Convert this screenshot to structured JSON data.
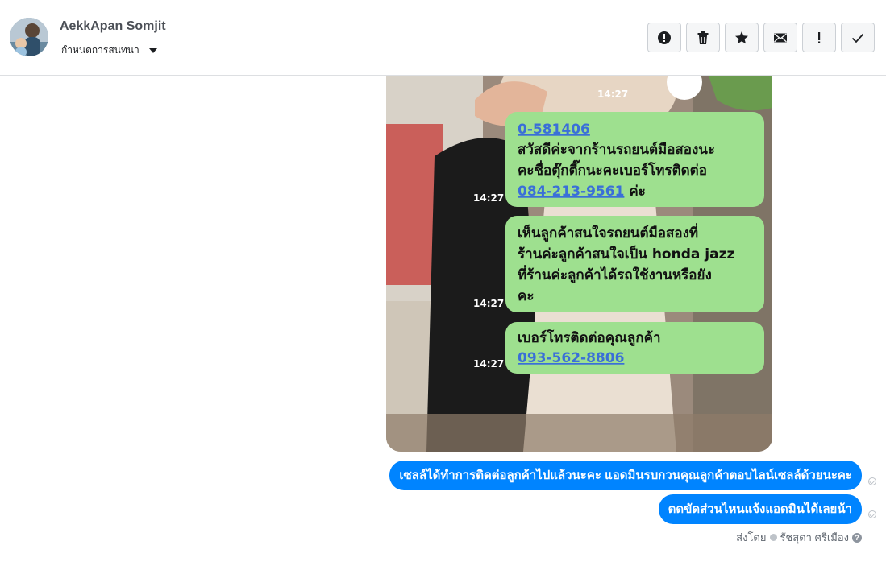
{
  "header": {
    "contact_name": "AekkApan Somjit",
    "assign_label": "กำหนดการสนทนา"
  },
  "toolbar": {
    "buttons": [
      {
        "icon": "alert-circle-icon"
      },
      {
        "icon": "trash-icon"
      },
      {
        "icon": "star-icon"
      },
      {
        "icon": "envelope-icon"
      },
      {
        "icon": "exclamation-icon"
      },
      {
        "icon": "check-icon"
      }
    ]
  },
  "image_message": {
    "timestamps": [
      "14:27",
      "14:27",
      "14:27",
      "14:27"
    ],
    "bubbles": [
      {
        "link1": "0-581406",
        "line1": "สวัสดีค่ะจากร้านรถยนต์มือสองนะ",
        "line2": "คะชื่อตุ๊กตี๊กนะคะเบอร์โทรติดต่อ",
        "link2": "084-213-9561",
        "suffix": " ค่ะ"
      },
      {
        "line1": "เห็นลูกค้าสนใจรถยนต์มือสองที่",
        "line2": "ร้านค่ะลูกค้าสนใจเป็น honda jazz",
        "line3": "ที่ร้านค่ะลูกค้าได้รถใช้งานหรือยัง",
        "line4": "คะ"
      },
      {
        "line1": "เบอร์โทรติดต่อคุณลูกค้า",
        "link1": "093-562-8806"
      }
    ]
  },
  "messages": [
    {
      "text": "เซลล์ได้ทำการติดต่อลูกค้าไปแล้วนะคะ  แอดมินรบกวนคุณลูกค้าตอบไลน์เซลล์ด้วยนะคะ"
    },
    {
      "text": "ตดขัดส่วนไหนแจ้งแอดมินได้เลยน้า"
    }
  ],
  "sent_by": {
    "label": "ส่งโดย",
    "name": "รัชสุดา ศรีเมือง"
  },
  "colors": {
    "bubble_blue": "#0084ff",
    "line_green": "#9ee08f",
    "link_blue": "#3a6fd8"
  }
}
